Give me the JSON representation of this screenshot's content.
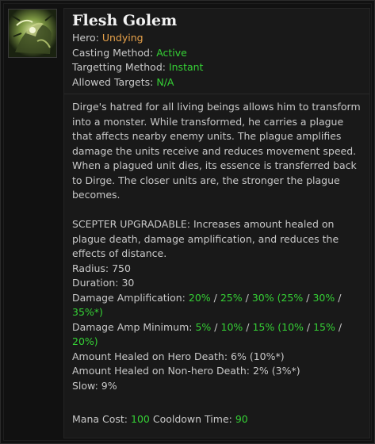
{
  "ability": {
    "name": "Flesh Golem",
    "icon": "flesh-golem-ability-icon"
  },
  "meta": {
    "hero_label": "Hero:",
    "hero_value": "Undying",
    "casting_label": "Casting Method:",
    "casting_value": "Active",
    "targetting_label": "Targetting Method:",
    "targetting_value": "Instant",
    "targets_label": "Allowed Targets:",
    "targets_value": "N/A"
  },
  "description": "Dirge's hatred for all living beings allows him to transform into a monster. While transformed, he carries a plague that affects nearby enemy units. The plague amplifies damage the units receive and reduces movement speed. When a plagued unit dies, its essence is transferred back to Dirge. The closer units are, the stronger the plague becomes.",
  "scepter": "SCEPTER UPGRADABLE: Increases amount healed on plague death, damage amplification, and reduces the effects of distance.",
  "stats": {
    "radius": "Radius: 750",
    "duration": "Duration: 30",
    "amp_label": "Damage Amplification:",
    "amp_v1": "20%",
    "amp_v2": "25%",
    "amp_v3": "30%",
    "amp_s1": "(25%",
    "amp_s2": "30%",
    "amp_s3": "35%*)",
    "min_label": "Damage Amp Minimum:",
    "min_v1": "5%",
    "min_v2": "10%",
    "min_v3": "15%",
    "min_s1": "(10%",
    "min_s2": "15%",
    "min_s3": "20%)",
    "heal_hero": "Amount Healed on Hero Death: 6% (10%*)",
    "heal_nonhero": "Amount Healed on Non-hero Death: 2% (3%*)",
    "slow": "Slow: 9%"
  },
  "costs": {
    "mana_label": "Mana Cost:",
    "mana_value": "100",
    "cooldown_label": "Cooldown Time:",
    "cooldown_value": "90"
  },
  "colors": {
    "hero": "#e8a24a",
    "value_green": "#35d135",
    "text": "#c8c8c8",
    "title": "#f2f2f2"
  }
}
